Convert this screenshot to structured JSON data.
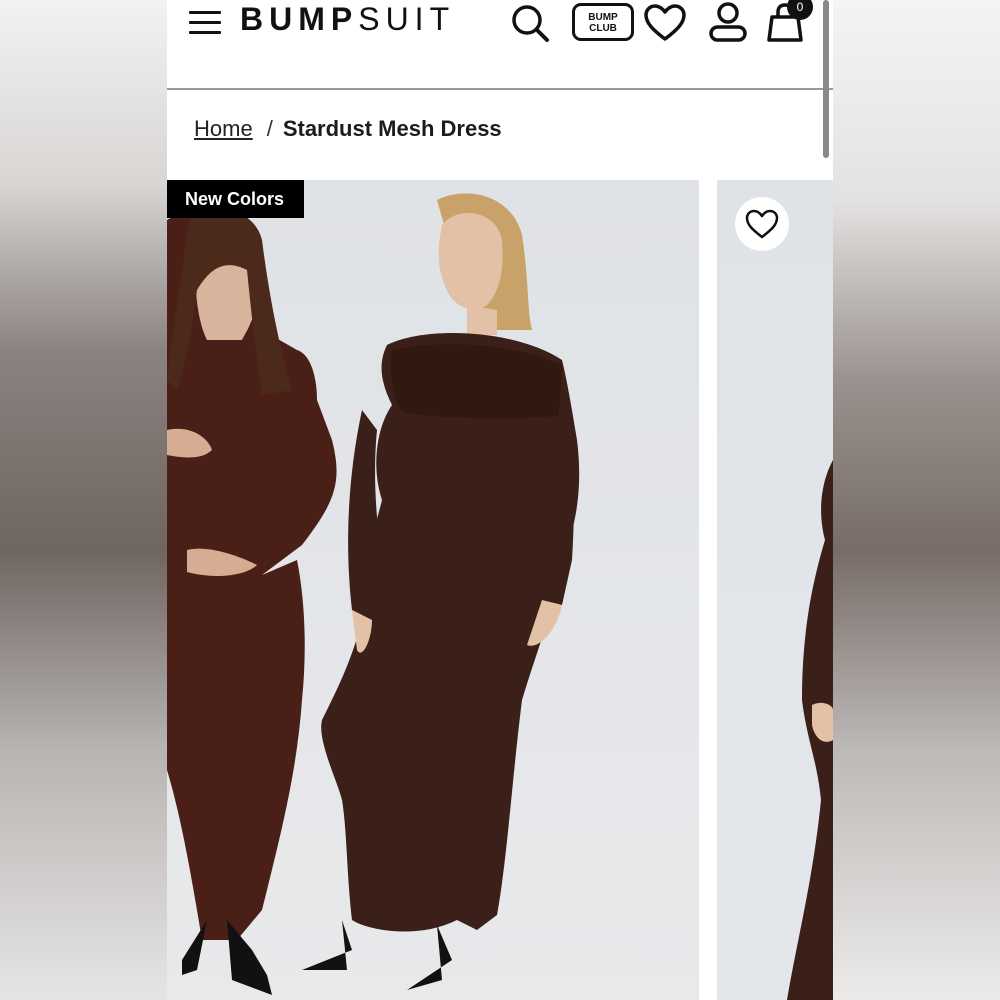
{
  "header": {
    "logo_bold": "BUMP",
    "logo_light": "SUIT",
    "bump_club_line1": "BUMP",
    "bump_club_line2": "CLUB",
    "cart_count": "0",
    "icons": [
      "menu-icon",
      "search-icon",
      "heart-icon",
      "account-icon",
      "bag-icon"
    ]
  },
  "breadcrumb": {
    "home": "Home",
    "separator": "/",
    "current": "Stardust Mesh Dress"
  },
  "gallery": {
    "badge": "New Colors"
  },
  "colors": {
    "dress_left": "#4a1f18",
    "dress_right": "#3a2018",
    "backdrop": "#e1e3e7"
  }
}
